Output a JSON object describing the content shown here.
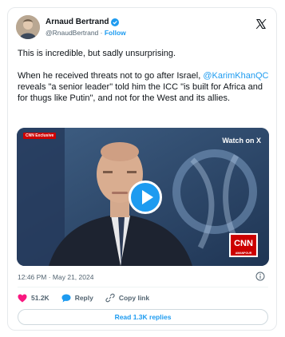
{
  "author": {
    "display_name": "Arnaud Bertrand",
    "handle": "@RnaudBertrand",
    "separator": " · ",
    "follow_label": "Follow"
  },
  "tweet": {
    "line1": "This is incredible, but sadly unsurprising.",
    "p2_before": "When he received threats not to go after Israel, ",
    "mention": "@KarimKhanQC",
    "p2_after": " reveals \"a senior leader\" told him the ICC \"is built for Africa and for thugs like Putin\", and not for the West and its allies."
  },
  "media": {
    "tag": "CNN Exclusive",
    "watch_label": "Watch on X",
    "logo_text": "CNN",
    "logo_sub": "AMANPOUR"
  },
  "timestamp": "12:46 PM · May 21, 2024",
  "actions": {
    "likes": "51.2K",
    "reply_label": "Reply",
    "copy_label": "Copy link"
  },
  "read_replies_label": "Read 1.3K replies",
  "colors": {
    "accent": "#1d9bf0",
    "like": "#f91880",
    "text": "#0f1419",
    "muted": "#536471"
  }
}
